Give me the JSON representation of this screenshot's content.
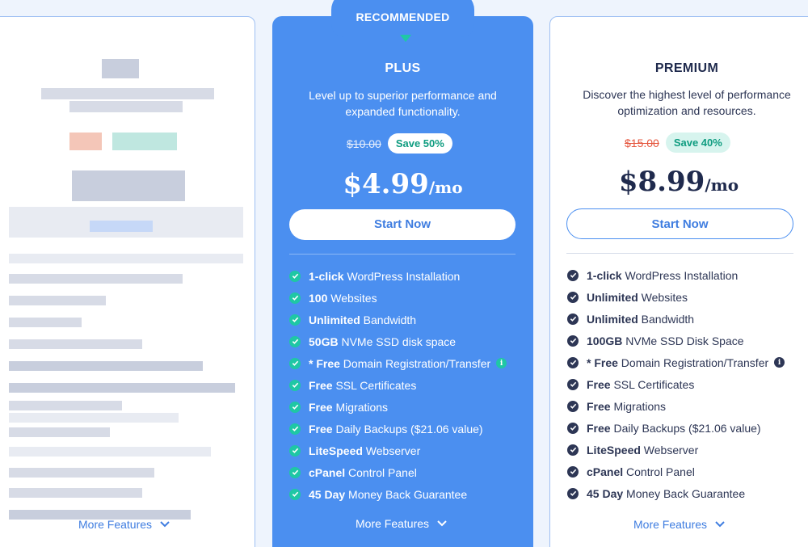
{
  "plus": {
    "badge": "RECOMMENDED",
    "name": "PLUS",
    "desc_line1": "Level up to superior performance and",
    "desc_line2": "expanded functionality.",
    "old_price": "$10.00",
    "save": "Save 50%",
    "price": "$4.99",
    "per": "/mo",
    "cta": "Start Now",
    "features": [
      {
        "bold": "1-click",
        "rest": " WordPress Installation"
      },
      {
        "bold": "100",
        "rest": " Websites"
      },
      {
        "bold": "Unlimited",
        "rest": " Bandwidth"
      },
      {
        "bold": "50GB",
        "rest": " NVMe SSD disk space"
      },
      {
        "bold": "* Free",
        "rest": " Domain Registration/Transfer"
      },
      {
        "bold": "Free",
        "rest": " SSL Certificates"
      },
      {
        "bold": "Free",
        "rest": " Migrations"
      },
      {
        "bold": "Free",
        "rest": " Daily Backups ($21.06 value)"
      },
      {
        "bold": "LiteSpeed",
        "rest": " Webserver"
      },
      {
        "bold": "cPanel",
        "rest": " Control Panel"
      },
      {
        "bold": "45 Day",
        "rest": " Money Back Guarantee"
      }
    ],
    "more": "More Features"
  },
  "premium": {
    "name": "PREMIUM",
    "desc_line1": "Discover the highest level of performance",
    "desc_line2": "optimization and resources.",
    "old_price": "$15.00",
    "save": "Save 40%",
    "price": "$8.99",
    "per": "/mo",
    "cta": "Start Now",
    "features": [
      {
        "bold": "1-click",
        "rest": " WordPress Installation"
      },
      {
        "bold": "Unlimited",
        "rest": " Websites"
      },
      {
        "bold": "Unlimited",
        "rest": " Bandwidth"
      },
      {
        "bold": "100GB",
        "rest": " NVMe SSD Disk Space"
      },
      {
        "bold": "* Free",
        "rest": " Domain Registration/Transfer"
      },
      {
        "bold": "Free",
        "rest": " SSL Certificates"
      },
      {
        "bold": "Free",
        "rest": " Migrations"
      },
      {
        "bold": "Free",
        "rest": " Daily Backups ($21.06 value)"
      },
      {
        "bold": "LiteSpeed",
        "rest": " Webserver"
      },
      {
        "bold": "cPanel",
        "rest": " Control Panel"
      },
      {
        "bold": "45 Day",
        "rest": " Money Back Guarantee"
      }
    ],
    "more": "More Features"
  },
  "left": {
    "more": "More Features"
  },
  "colors": {
    "accent_blue": "#4b8ff0",
    "dark_navy": "#1f2a4d",
    "teal": "#1fc7a5",
    "old_price_red": "#e5573f"
  }
}
